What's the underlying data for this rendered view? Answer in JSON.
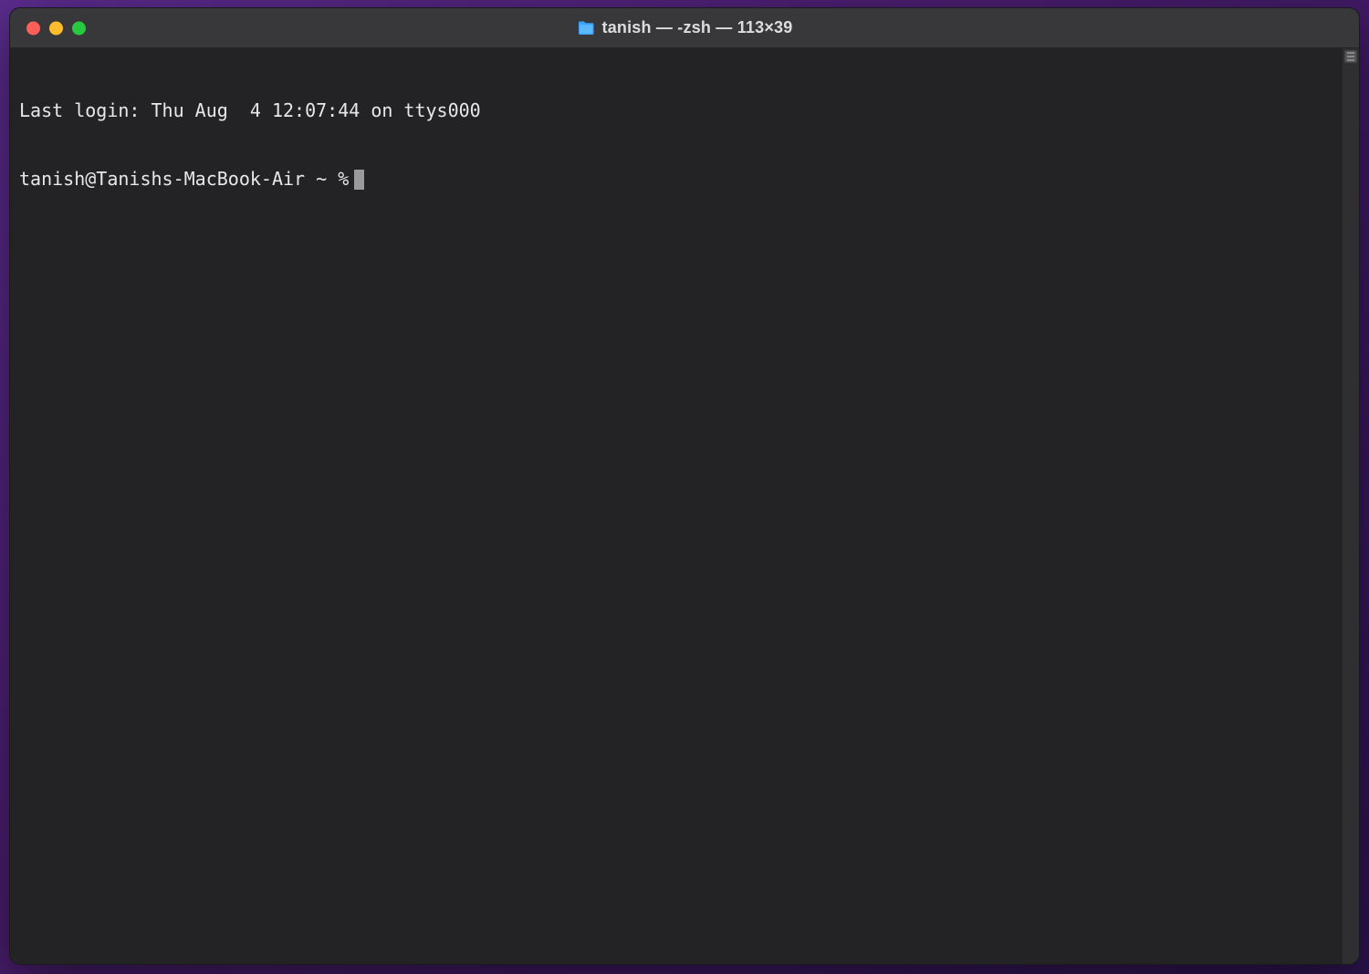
{
  "window": {
    "title": "tanish — -zsh — 113×39"
  },
  "terminal": {
    "last_login_line": "Last login: Thu Aug  4 12:07:44 on ttys000",
    "prompt": "tanish@Tanishs-MacBook-Air ~ %"
  },
  "colors": {
    "close": "#ff5f57",
    "minimize": "#ffbd2e",
    "maximize": "#28c940",
    "body_bg": "#232325",
    "titlebar_bg": "#38383b"
  }
}
